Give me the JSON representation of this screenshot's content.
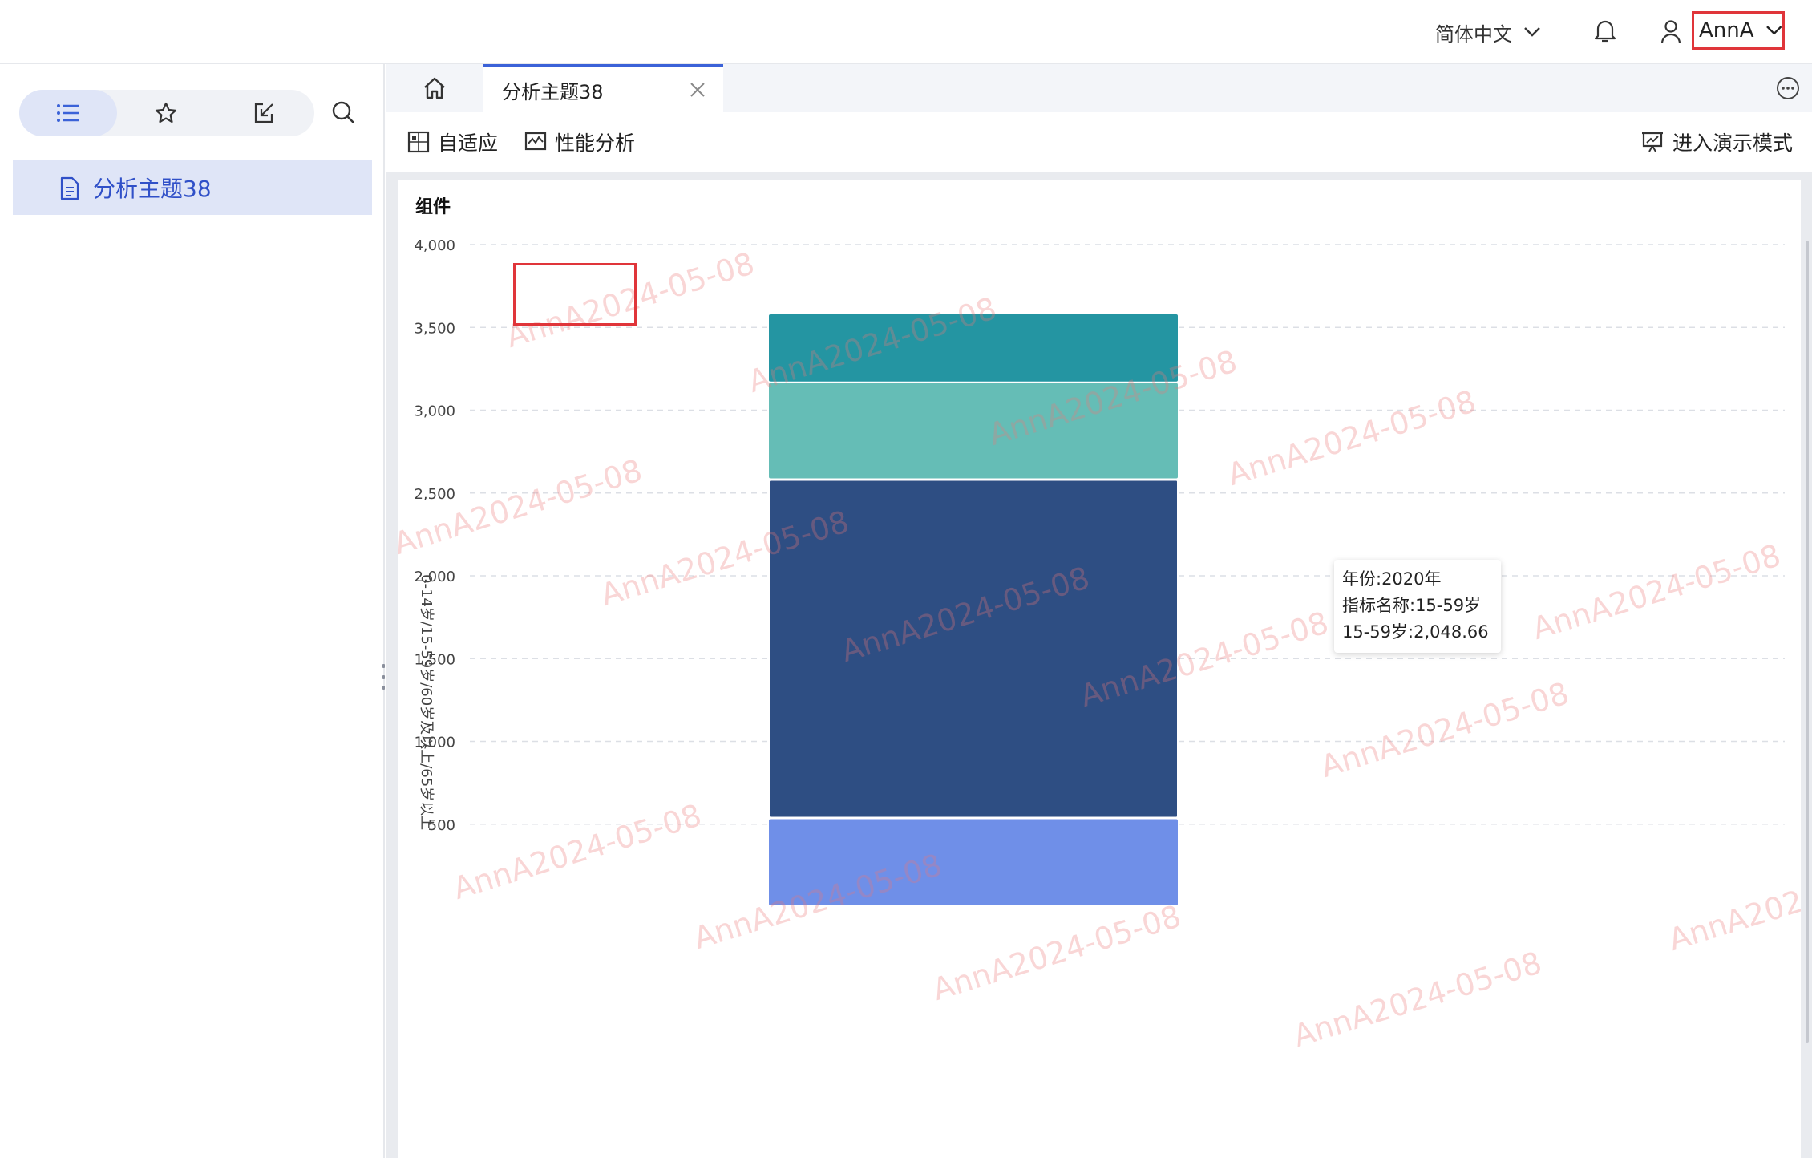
{
  "header": {
    "language": "简体中文",
    "user_name": "AnnA"
  },
  "sidebar": {
    "items": [
      {
        "label": "分析主题38"
      }
    ]
  },
  "tabs": [
    {
      "label": "分析主题38"
    }
  ],
  "toolbar": {
    "adapt_label": "自适应",
    "perf_label": "性能分析",
    "present_label": "进入演示模式"
  },
  "panel": {
    "title": "组件"
  },
  "watermark": {
    "text": "AnnA2024-05-08"
  },
  "chart_data": {
    "type": "bar",
    "stacked": true,
    "title": "",
    "xlabel": "",
    "ylabel": "0-14岁/15-59岁/60岁及以上/65岁以上",
    "ylim": [
      0,
      4000
    ],
    "yticks": [
      500,
      1000,
      1500,
      2000,
      2500,
      3000,
      3500,
      4000
    ],
    "ytick_labels": [
      "500",
      "1,000",
      "1,500",
      "2,000",
      "2,500",
      "3,000",
      "3,500",
      "4,000"
    ],
    "grid": true,
    "categories": [
      "2020年"
    ],
    "series": [
      {
        "name": "0-14岁",
        "values": [
          530
        ],
        "color": "#6f8fe8"
      },
      {
        "name": "15-59岁",
        "values": [
          2048.66
        ],
        "color": "#2e4e83"
      },
      {
        "name": "",
        "values": [
          585
        ],
        "color": "#65bdb6"
      },
      {
        "name": "",
        "values": [
          415
        ],
        "color": "#2495a2"
      }
    ],
    "tooltip": {
      "lines": [
        "年份:2020年",
        "指标名称:15-59岁",
        "15-59岁:2,048.66"
      ]
    }
  },
  "colors": {
    "accent": "#3b62d8",
    "highlight_border": "#e0353a",
    "sidebar_active_bg": "#dfe5f7"
  }
}
